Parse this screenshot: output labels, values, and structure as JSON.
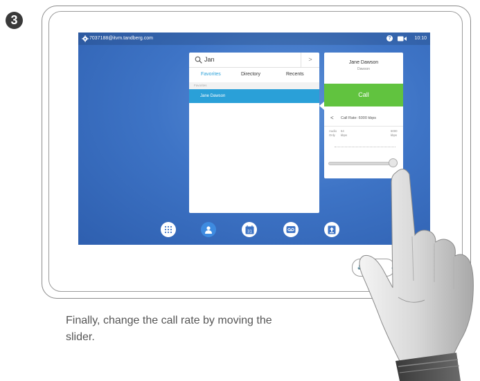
{
  "step_number": "3",
  "topbar": {
    "address": "7037188@itvm.tandberg.com",
    "time": "10:10"
  },
  "directory": {
    "search_value": "Jan",
    "search_arrow": ">",
    "tabs": [
      "Favorites",
      "Directory",
      "Recents"
    ],
    "active_tab": "Favorites",
    "section_label": "Favorites",
    "contacts": [
      "Jane Dawson"
    ]
  },
  "call_panel": {
    "name": "Jane Dawson",
    "subtitle": "Dawson",
    "call_label": "Call",
    "back_symbol": "<",
    "rate_label": "Call Rate: 6000 kbps",
    "slider_left_label_1": "Audio",
    "slider_left_label_2": "Only",
    "slider_mid_label_1": "64",
    "slider_mid_label_2": "kbps",
    "slider_right_label_1": "6000",
    "slider_right_label_2": "kbps",
    "slider_value_fraction": 1.0
  },
  "dock_icons": [
    "keypad-icon",
    "contacts-icon",
    "calendar-icon",
    "voicemail-icon",
    "share-icon"
  ],
  "calendar_day": "31",
  "caption": "Finally, change the call rate by moving the slider.",
  "colors": {
    "screen_blue": "#3e74c6",
    "accent_blue": "#2aa0d8",
    "call_green": "#61c33f"
  }
}
